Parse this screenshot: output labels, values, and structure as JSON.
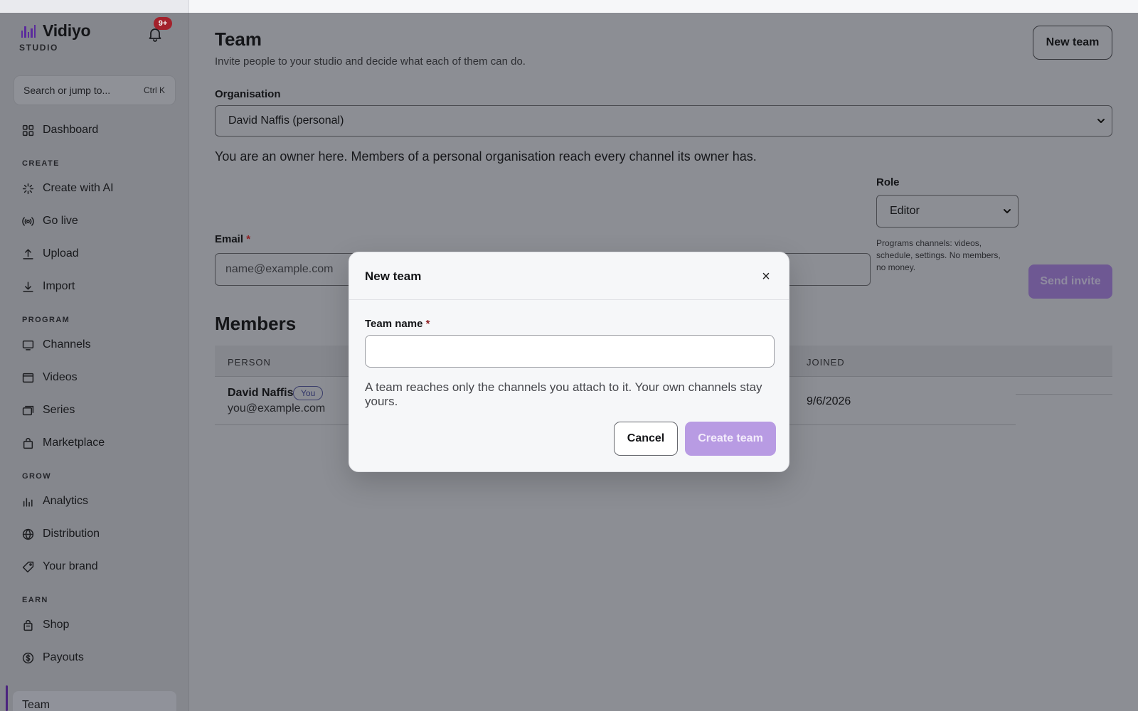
{
  "app": {
    "name": "Vidiyo",
    "subtitle": "STUDIO",
    "notification_badge": "9+"
  },
  "search": {
    "placeholder": "Search or jump to...",
    "shortcut": "Ctrl K"
  },
  "sidebar": {
    "dashboard": {
      "label": "Dashboard",
      "icon": "grid-icon"
    },
    "sections": [
      {
        "label": "CREATE",
        "items": [
          {
            "label": "Create with AI",
            "icon": "sparkle-icon"
          },
          {
            "label": "Go live",
            "icon": "broadcast-icon"
          },
          {
            "label": "Upload",
            "icon": "upload-icon"
          },
          {
            "label": "Import",
            "icon": "download-icon"
          }
        ]
      },
      {
        "label": "PROGRAM",
        "items": [
          {
            "label": "Channels",
            "icon": "monitor-icon"
          },
          {
            "label": "Videos",
            "icon": "video-icon"
          },
          {
            "label": "Series",
            "icon": "stack-icon"
          },
          {
            "label": "Marketplace",
            "icon": "bag-icon"
          }
        ]
      },
      {
        "label": "GROW",
        "items": [
          {
            "label": "Analytics",
            "icon": "bar-chart-icon"
          },
          {
            "label": "Distribution",
            "icon": "globe-icon"
          },
          {
            "label": "Your brand",
            "icon": "tag-icon"
          }
        ]
      },
      {
        "label": "EARN",
        "items": [
          {
            "label": "Shop",
            "icon": "shopping-bag-icon"
          },
          {
            "label": "Payouts",
            "icon": "dollar-icon"
          }
        ]
      }
    ],
    "active": {
      "label": "Team"
    }
  },
  "page": {
    "title": "Team",
    "subtitle": "Invite people to your studio and decide what each of them can do.",
    "new_team_button": "New team",
    "organisation_label": "Organisation",
    "organisation_value": "David Naffis (personal)",
    "organisation_note": "You are an owner here. Members of a personal organisation reach every channel its owner has.",
    "role_label": "Role",
    "role_value": "Editor",
    "role_help": "Programs channels: videos, schedule, settings. No members, no money.",
    "email_label": "Email",
    "email_required": "*",
    "email_placeholder": "name@example.com",
    "send_invite_button": "Send invite",
    "members_title": "Members",
    "members_table": {
      "columns": [
        "PERSON",
        "JOINED"
      ],
      "rows": [
        {
          "name": "David Naffis",
          "badge": "You",
          "email": "you@example.com",
          "joined": "9/6/2026"
        }
      ]
    }
  },
  "modal": {
    "title": "New team",
    "close_label": "×",
    "team_name_label": "Team name",
    "required_mark": "*",
    "help": "A team reaches only the channels you attach to it. Your own channels stay yours.",
    "cancel_button": "Cancel",
    "create_button": "Create team"
  },
  "colors": {
    "accent": "#b89be3",
    "brand": "#5b2b9c",
    "danger": "#a3212b"
  }
}
